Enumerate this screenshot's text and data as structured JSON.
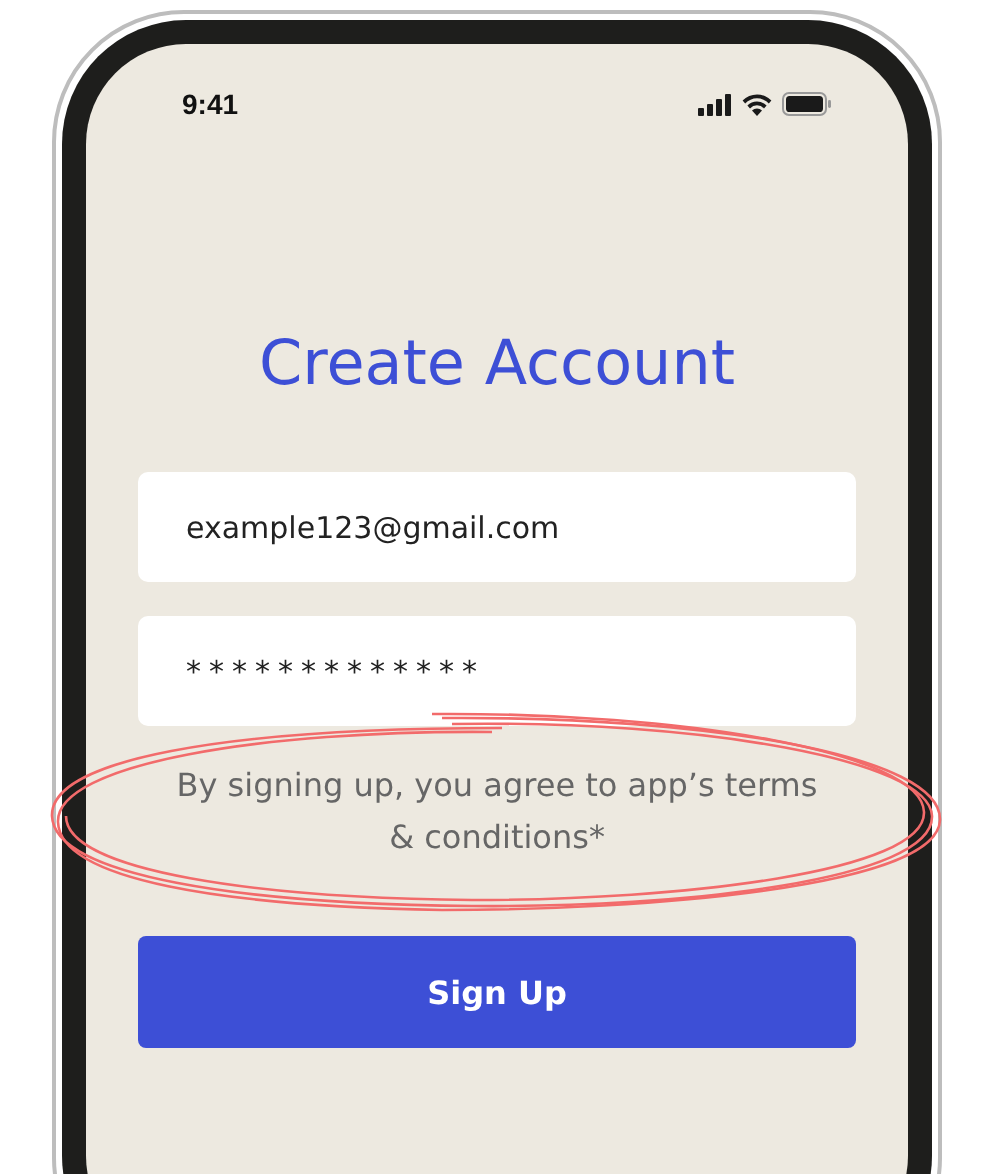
{
  "status_bar": {
    "time": "9:41"
  },
  "title": "Create Account",
  "fields": [
    {
      "kind": "email",
      "value": "example123@gmail.com"
    },
    {
      "kind": "password",
      "value": "*************"
    }
  ],
  "terms": "By signing up, you agree to app’s terms & conditions*",
  "button": "Sign Up"
}
